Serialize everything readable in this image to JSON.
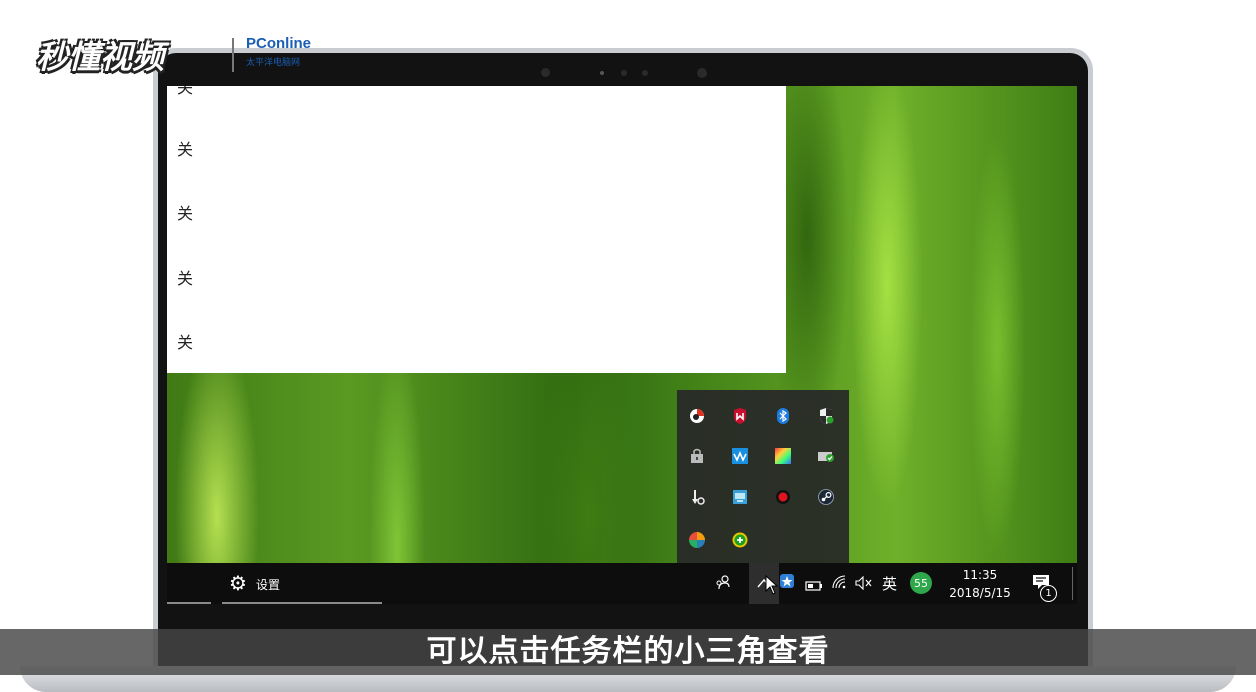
{
  "watermark": {
    "brand": "秒懂视频",
    "partner": "PConline",
    "partner_sub": "太平洋电脑网"
  },
  "settings_panel": {
    "toggle_labels": [
      "关",
      "关",
      "关",
      "关",
      "关"
    ]
  },
  "tray_overflow": {
    "icons": [
      "record-icon",
      "mcafee-shield-icon",
      "bluetooth-icon",
      "security-shield-icon",
      "lock-icon",
      "audio-wave-icon",
      "color-palette-icon",
      "checkmark-device-icon",
      "usb-settings-icon",
      "display-icon",
      "red-dot-icon",
      "steam-icon",
      "pinwheel-icon",
      "green-plus-icon"
    ]
  },
  "taskbar": {
    "settings_label": "设置",
    "ime_label": "英",
    "badge_number": "55",
    "time": "11:35",
    "date": "2018/5/15",
    "notification_count": "1"
  },
  "caption": {
    "text": "可以点击任务栏的小三角查看"
  }
}
